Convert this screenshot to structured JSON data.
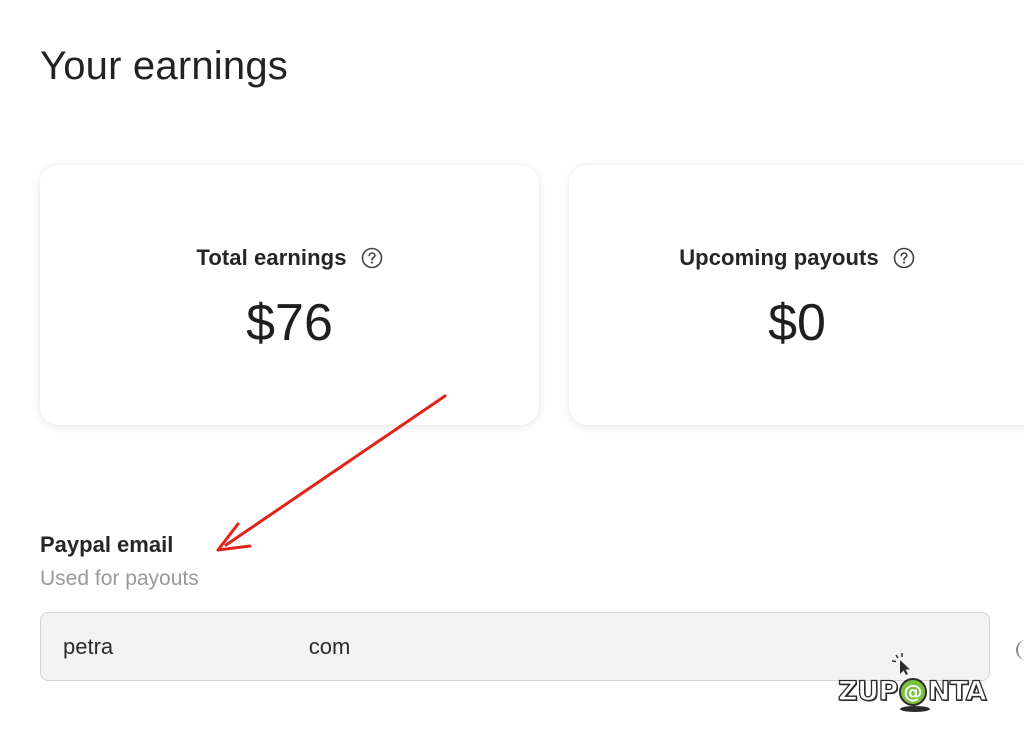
{
  "header": {
    "title": "Your earnings"
  },
  "cards": {
    "total_earnings": {
      "label": "Total earnings",
      "value": "$76",
      "help_icon": "question-circle-icon"
    },
    "upcoming_payouts": {
      "label": "Upcoming payouts",
      "value": "$0",
      "help_icon": "question-circle-icon"
    }
  },
  "paypal": {
    "label": "Paypal email",
    "helper_text": "Used for payouts",
    "value": "petra                                com"
  },
  "annotation": {
    "color": "#e0241c"
  },
  "watermark": {
    "text_before": "ZUP",
    "at": "@",
    "text_after": "NTA",
    "accent": "#7cc242"
  }
}
